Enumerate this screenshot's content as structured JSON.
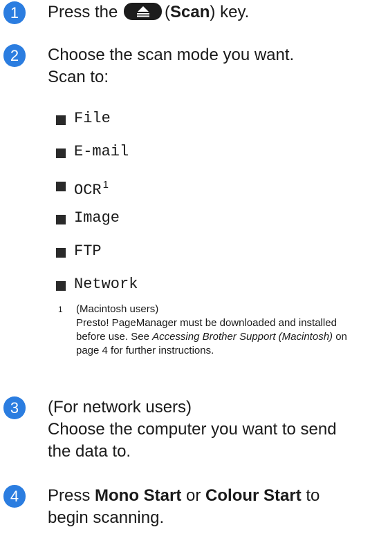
{
  "steps": [
    {
      "number": "1",
      "prefix": "Press the ",
      "key_name": "Scan",
      "suffix": " key."
    },
    {
      "number": "2",
      "line1": "Choose the scan mode you want.",
      "line2": "Scan to:"
    },
    {
      "number": "3",
      "line1": "(For network users)",
      "line2": "Choose the computer you want to send the data to."
    },
    {
      "number": "4",
      "prefix": "Press ",
      "bold1": "Mono Start",
      "middle": " or ",
      "bold2": "Colour Start",
      "suffix": " to begin scanning."
    }
  ],
  "scan_options": [
    "File",
    "E-mail",
    "OCR",
    "Image",
    "FTP",
    "Network"
  ],
  "ocr_footnote_ref": "1",
  "footnote": {
    "mark": "1",
    "line1": "(Macintosh users)",
    "text_before_link": "Presto! PageManager must be downloaded and installed before use. See ",
    "link_text": "Accessing Brother Support (Macintosh)",
    "text_after_link": " on page 4 for further instructions."
  },
  "icons": {
    "scan_key": "scan-key-icon"
  },
  "colors": {
    "step_badge": "#2b7de0",
    "text": "#1a1a1a"
  }
}
